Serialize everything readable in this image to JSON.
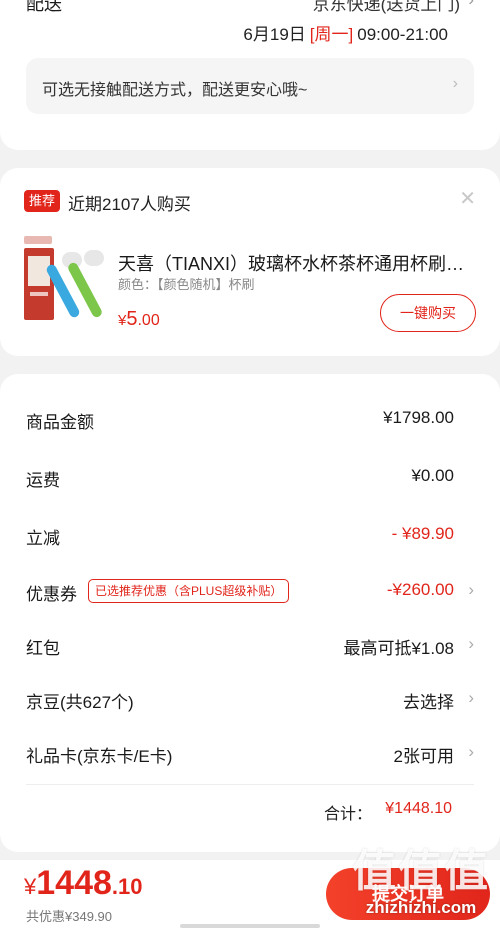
{
  "delivery": {
    "label": "配送",
    "carrier": "京东快递(送货上门)",
    "date": "6月19日",
    "weekday": "[周一]",
    "time": "09:00-21:00",
    "contactless": "可选无接触配送方式，配送更安心哦~"
  },
  "recommend": {
    "badge": "推荐",
    "title": "近期2107人购买",
    "product_name": "天喜（TIANXI）玻璃杯水杯茶杯通用杯刷…",
    "spec": "颜色：【颜色随机】杯刷",
    "price_currency": "¥",
    "price_int": "5",
    "price_dec": ".00",
    "buy_label": "一键购买"
  },
  "amounts": {
    "goods": {
      "label": "商品金额",
      "value": "¥1798.00"
    },
    "shipping": {
      "label": "运费",
      "value": "¥0.00"
    },
    "discount": {
      "label": "立减",
      "value": "- ¥89.90"
    },
    "coupon": {
      "label": "优惠券",
      "tag": "已选推荐优惠（含PLUS超级补贴）",
      "value": "-¥260.00"
    },
    "redpacket": {
      "label": "红包",
      "value": "最高可抵¥1.08"
    },
    "jingdou": {
      "label": "京豆(共627个)",
      "value": "去选择"
    },
    "giftcard": {
      "label": "礼品卡(京东卡/E卡)",
      "value": "2张可用"
    },
    "total_label": "合计：",
    "total_value": "¥1448.10"
  },
  "bottom": {
    "price_currency": "¥",
    "price_int": "1448",
    "price_dec": ".10",
    "saved": "共优惠¥349.90",
    "submit": "提交订单"
  },
  "watermark": {
    "glyphs": "值值值",
    "url": "zhizhizhi.com"
  },
  "colors": {
    "accent": "#e1251b",
    "background": "#f2f2f2"
  }
}
